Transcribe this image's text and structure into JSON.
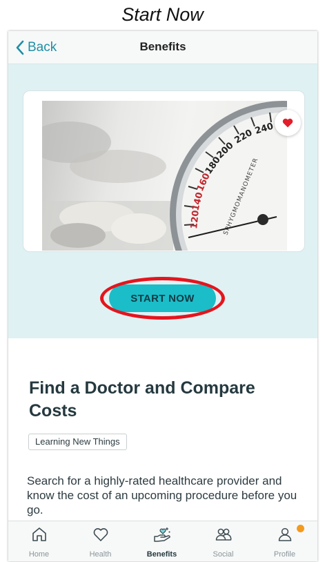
{
  "caption": "Start Now",
  "header": {
    "back_label": "Back",
    "title": "Benefits"
  },
  "hero": {
    "image_subject": "sphygmomanometer-gauge",
    "gauge_text": {
      "brand": "SPHYGMOMANOMETER",
      "ticks": [
        "120",
        "140",
        "160",
        "180",
        "200",
        "220",
        "240"
      ]
    },
    "favorite_icon": "heart-icon",
    "cta_label": "START NOW"
  },
  "content": {
    "heading": "Find a Doctor and Compare Costs",
    "tag": "Learning New Things",
    "description": "Search for a highly-rated healthcare provider and know the cost of an upcoming procedure before you go."
  },
  "tabs": [
    {
      "label": "Home",
      "icon": "home-icon"
    },
    {
      "label": "Health",
      "icon": "heart-outline-icon"
    },
    {
      "label": "Benefits",
      "icon": "hand-heart-icon",
      "active": true
    },
    {
      "label": "Social",
      "icon": "people-icon"
    },
    {
      "label": "Profile",
      "icon": "person-icon",
      "badge": true
    }
  ],
  "colors": {
    "accent": "#1e8fa5",
    "cta": "#1bbdc8",
    "hero_bg": "#dff1f3",
    "highlight_ring": "#e5141d",
    "badge": "#f29a1f"
  }
}
